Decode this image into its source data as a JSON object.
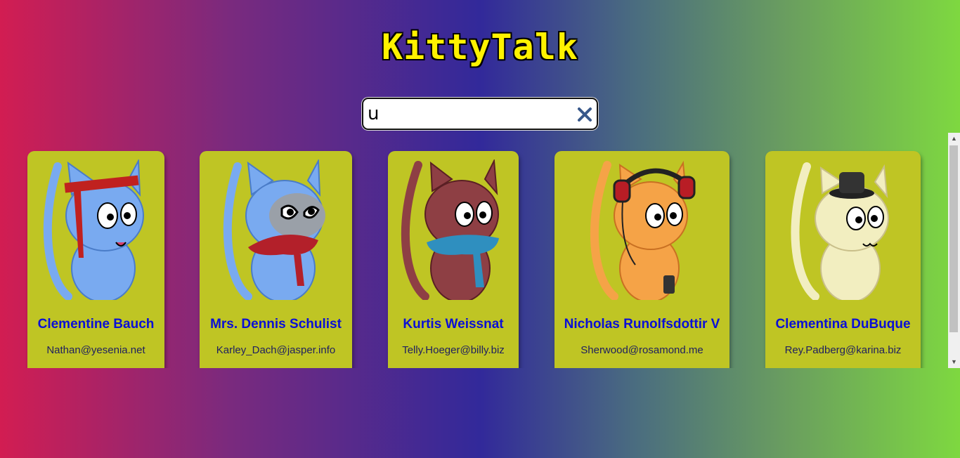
{
  "app": {
    "title": "KittyTalk"
  },
  "search": {
    "value": "u",
    "clear_icon": "close-icon"
  },
  "colors": {
    "card_bg": "#bfc524",
    "name": "#0a0fd6",
    "title": "#fff200"
  },
  "robots": [
    {
      "name": "Clementine Bauch",
      "email": "Nathan@yesenia.net",
      "fur": "#79aaf0",
      "accessory": "red-headband"
    },
    {
      "name": "Mrs. Dennis Schulist",
      "email": "Karley_Dach@jasper.info",
      "fur": "#79aaf0",
      "accessory": "red-scarf"
    },
    {
      "name": "Kurtis Weissnat",
      "email": "Telly.Hoeger@billy.biz",
      "fur": "#8e3f44",
      "accessory": "blue-scarf"
    },
    {
      "name": "Nicholas Runolfsdottir V",
      "email": "Sherwood@rosamond.me",
      "fur": "#f5a347",
      "accessory": "headphones"
    },
    {
      "name": "Clementina DuBuque",
      "email": "Rey.Padberg@karina.biz",
      "fur": "#f2eec0",
      "accessory": "top-hat"
    }
  ]
}
